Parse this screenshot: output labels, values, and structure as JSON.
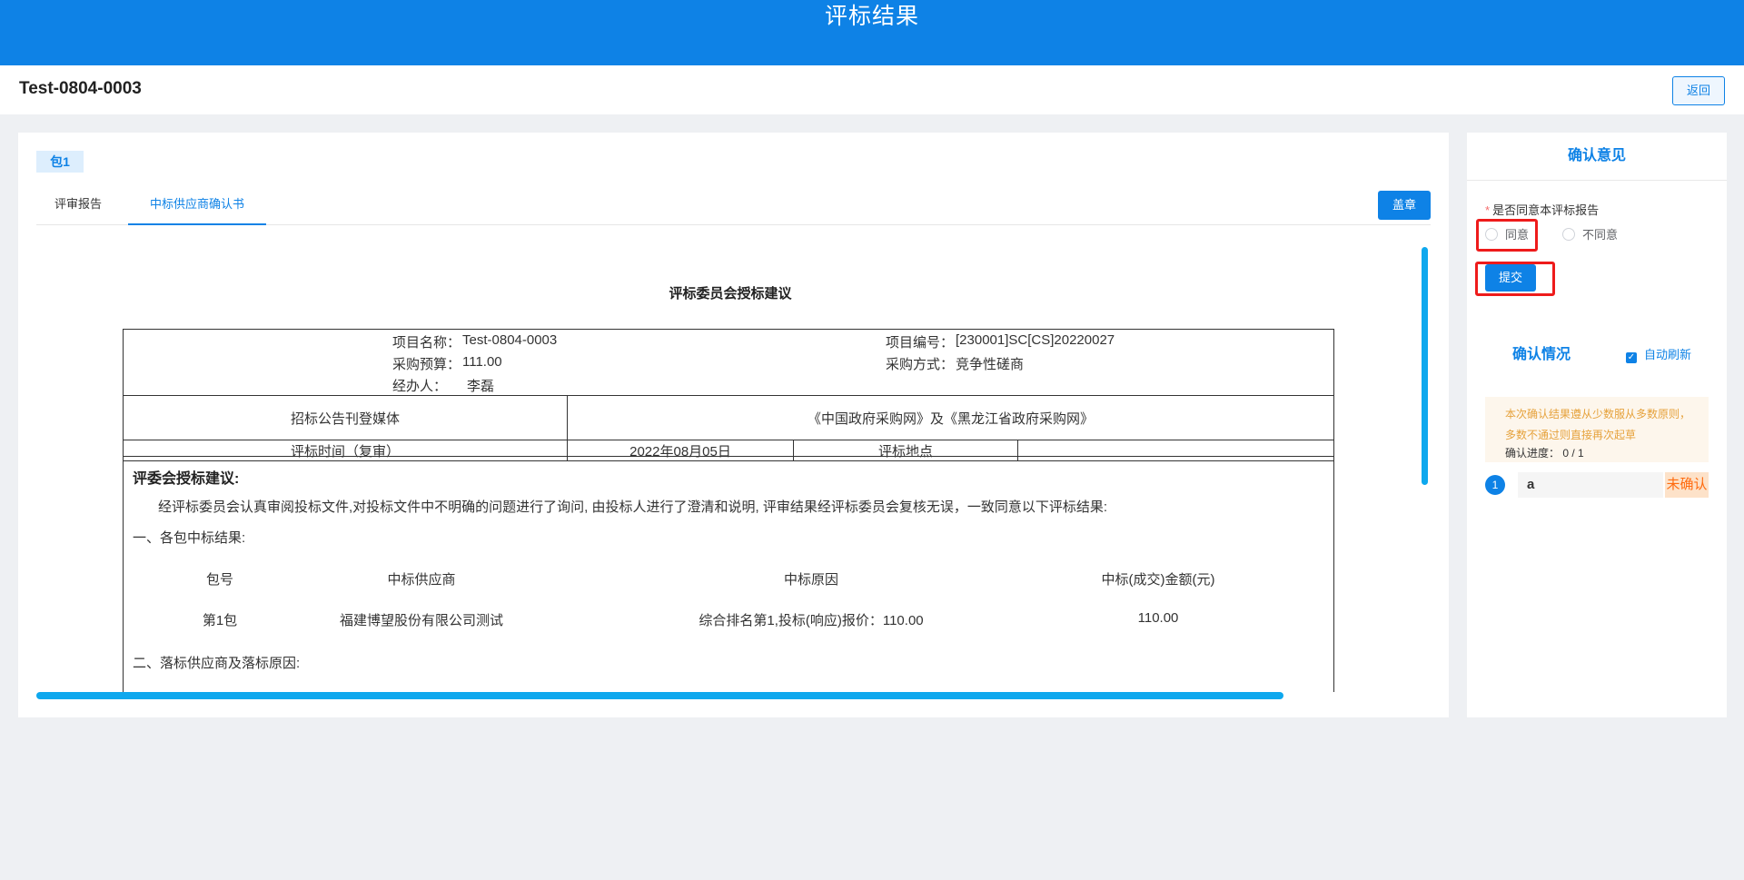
{
  "header": {
    "title": "评标结果"
  },
  "subheader": {
    "project_id": "Test-0804-0003",
    "back_label": "返回"
  },
  "main": {
    "package_tag": "包1",
    "tabs": [
      {
        "label": "评审报告"
      },
      {
        "label": "中标供应商确认书"
      }
    ],
    "stamp_label": "盖章",
    "document": {
      "title": "评标委员会授标建议",
      "info": {
        "project_name_label": "项目名称：",
        "project_name": "Test-0804-0003",
        "project_no_label": "项目编号：",
        "project_no": "[230001]SC[CS]20220027",
        "budget_label": "采购预算：",
        "budget": "111.00",
        "method_label": "采购方式：",
        "method": "竞争性磋商",
        "handler_label": "经办人：",
        "handler": "李磊"
      },
      "media_label": "招标公告刊登媒体",
      "media_value": "《中国政府采购网》及《黑龙江省政府采购网》",
      "time_label": "评标时间（复审）",
      "time_value": "2022年08月05日",
      "place_label": "评标地点",
      "place_value": "",
      "suggestion_heading": "评委会授标建议:",
      "suggestion_text": "经评标委员会认真审阅投标文件,对投标文件中不明确的问题进行了询问, 由投标人进行了澄清和说明, 评审结果经评标委员会复核无误，一致同意以下评标结果:",
      "section1": "一、各包中标结果:",
      "result_headers": [
        "包号",
        "中标供应商",
        "中标原因",
        "中标(成交)金额(元)"
      ],
      "result_row": [
        "第1包",
        "福建博望股份有限公司测试",
        "综合排名第1,投标(响应)报价：110.00",
        "110.00"
      ],
      "section2": "二、落标供应商及落标原因:"
    }
  },
  "side": {
    "title": "确认意见",
    "question": "是否同意本评标报告",
    "required_mark": "*",
    "options": [
      "同意",
      "不同意"
    ],
    "submit_label": "提交",
    "status_title": "确认情况",
    "auto_refresh_label": "自动刷新",
    "notice": "本次确认结果遵从少数服从多数原则，多数不通过则直接再次起草",
    "progress_label": "确认进度：",
    "progress_value": "0 / 1",
    "members": [
      {
        "index": "1",
        "name": "a",
        "status": "未确认"
      }
    ]
  },
  "colors": {
    "primary": "#0e82e6",
    "highlight": "#ee1b1b",
    "warning": "#e6a23c"
  }
}
